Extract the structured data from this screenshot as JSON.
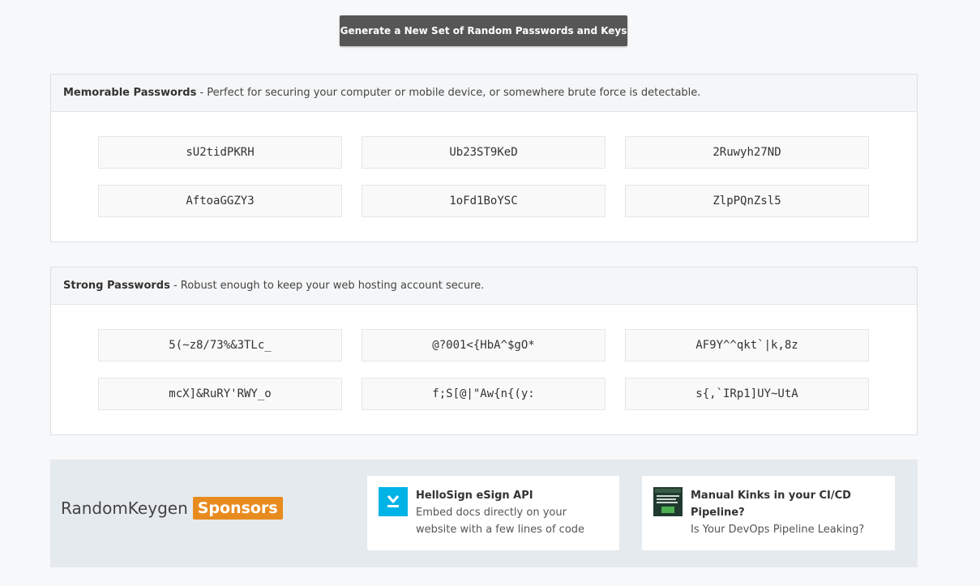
{
  "generate_button": {
    "label": "Generate a New Set of Random Passwords and Keys"
  },
  "memorable": {
    "title": "Memorable Passwords",
    "description": " - Perfect for securing your computer or mobile device, or somewhere brute force is detectable.",
    "passwords": [
      "sU2tidPKRH",
      "Ub23ST9KeD",
      "2Ruwyh27ND",
      "AftoaGGZY3",
      "1oFd1BoYSC",
      "ZlpPQnZsl5"
    ]
  },
  "strong": {
    "title": "Strong Passwords",
    "description": " - Robust enough to keep your web hosting account secure.",
    "passwords": [
      "5(~z8/73%&3TLc_",
      "@?001<{HbA^$gO*",
      "AF9Y^^qkt`|k,8z",
      "mcX]&RuRY'RWY_o",
      "f;S[@|\"Aw{n{(y:",
      "s{,`IRp1]UY~UtA"
    ]
  },
  "sponsors": {
    "brand": "RandomKeygen",
    "tag": "Sponsors",
    "ads": [
      {
        "icon": "hellosign-logo-icon",
        "title": "HelloSign eSign API",
        "line1": "Embed docs directly on your",
        "line2": "website with a few lines of code"
      },
      {
        "icon": "ebook-cover-icon",
        "title": "Manual Kinks in your CI/CD",
        "line1": "Pipeline?",
        "line2": "Is Your DevOps Pipeline Leaking?"
      }
    ]
  },
  "colors": {
    "button_bg": "#565656",
    "sponsor_tag": "#e88b1f",
    "hellosign_blue": "#00b3e6"
  }
}
